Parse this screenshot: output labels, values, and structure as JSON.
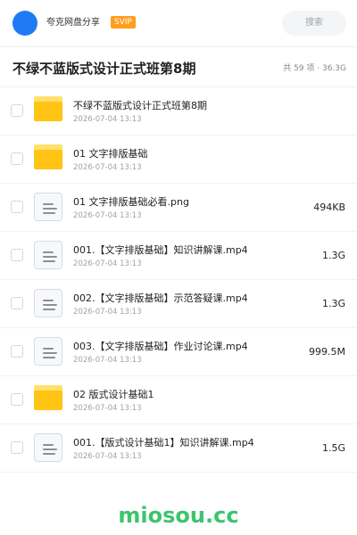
{
  "header": {
    "share_name": "夸克网盘分享",
    "badge": "SVIP",
    "search_label": "搜索"
  },
  "title_bar": {
    "title": "不绿不蓝版式设计正式班第8期",
    "summary": "共 59 项 · 36.3G"
  },
  "files": [
    {
      "type": "folder",
      "name": "不绿不蓝版式设计正式班第8期",
      "date": "2026-07-04 13:13",
      "size": ""
    },
    {
      "type": "folder",
      "name": "01 文字排版基础",
      "date": "2026-07-04 13:13",
      "size": ""
    },
    {
      "type": "file",
      "name": "01 文字排版基础必看.png",
      "date": "2026-07-04 13:13",
      "size": "494KB"
    },
    {
      "type": "file",
      "name": "001.【文字排版基础】知识讲解课.mp4",
      "date": "2026-07-04 13:13",
      "size": "1.3G"
    },
    {
      "type": "file",
      "name": "002.【文字排版基础】示范答疑课.mp4",
      "date": "2026-07-04 13:13",
      "size": "1.3G"
    },
    {
      "type": "file",
      "name": "003.【文字排版基础】作业讨论课.mp4",
      "date": "2026-07-04 13:13",
      "size": "999.5M"
    },
    {
      "type": "folder",
      "name": "02 版式设计基础1",
      "date": "2026-07-04 13:13",
      "size": ""
    },
    {
      "type": "file",
      "name": "001.【版式设计基础1】知识讲解课.mp4",
      "date": "2026-07-04 13:13",
      "size": "1.5G"
    }
  ],
  "watermark": "miosou.cc",
  "colors": {
    "avatar": "#1e7bf5",
    "badge": "#ff9e1b",
    "folder": "#ffc414",
    "watermark": "#3cc46e"
  }
}
